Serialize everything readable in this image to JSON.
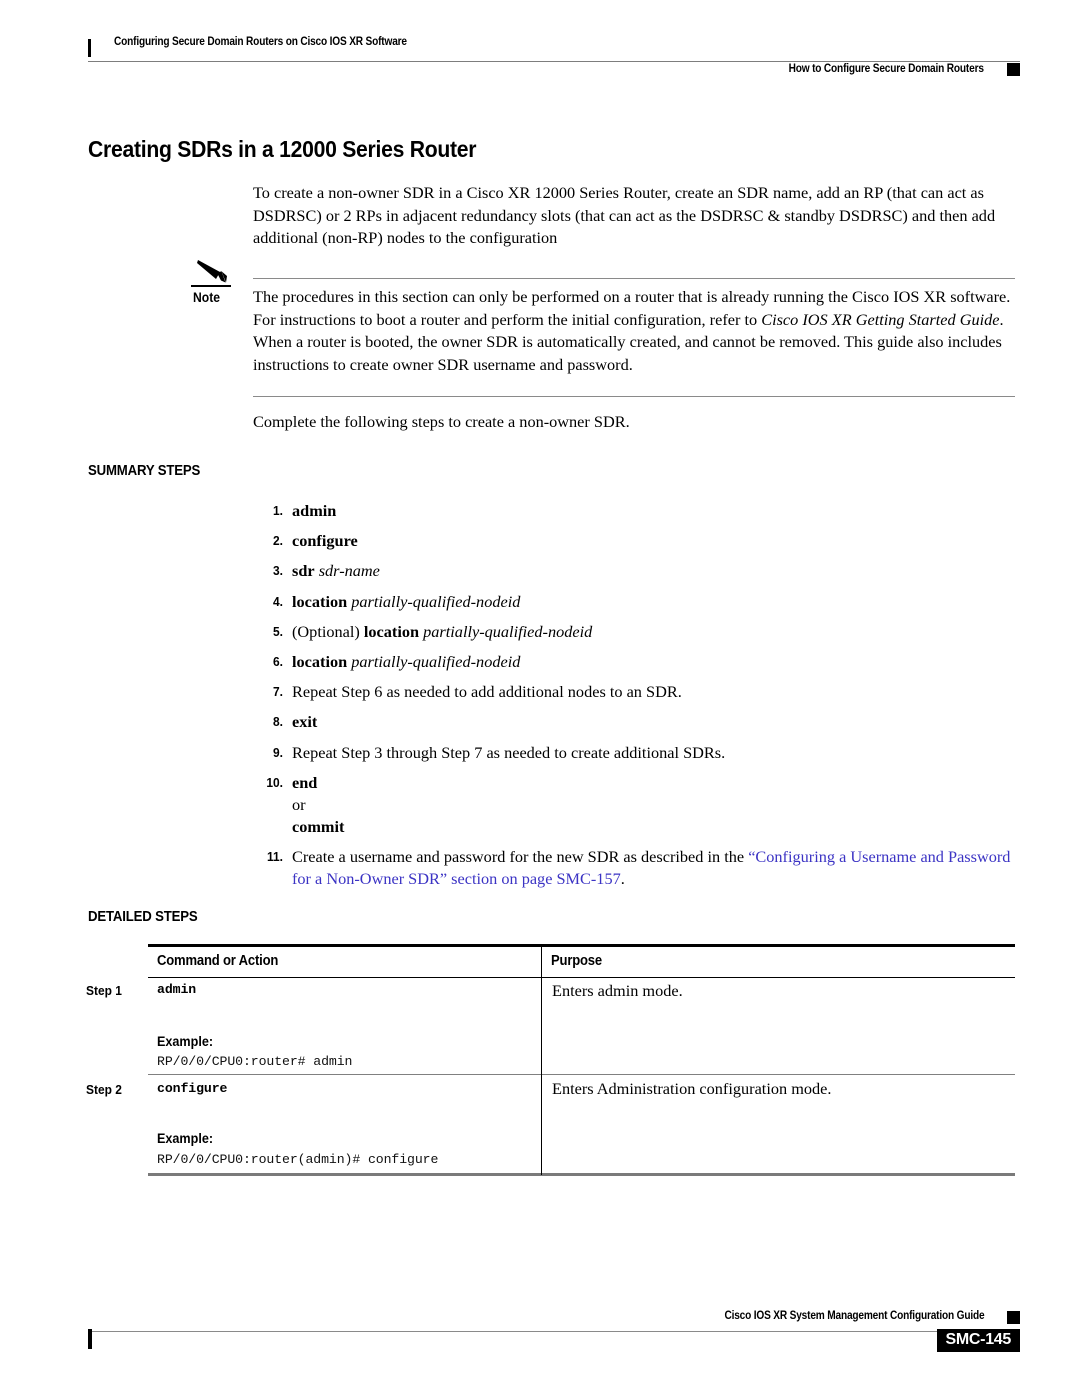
{
  "header": {
    "left_title": "Configuring Secure Domain Routers on Cisco IOS XR Software",
    "right_title": "How to Configure Secure Domain Routers"
  },
  "section": {
    "title": "Creating SDRs in a 12000 Series Router",
    "intro_paragraph": "To create a non-owner SDR in a Cisco XR 12000 Series Router, create an SDR name, add an RP (that can act as DSDRSC) or 2 RPs in adjacent redundancy slots (that can act as the DSDRSC & standby DSDRSC) and then add additional (non-RP) nodes to the configuration",
    "complete_paragraph": "Complete the following steps to create a non-owner SDR."
  },
  "note": {
    "label": "Note",
    "text_part_1": "The procedures in this section can only be performed on a router that is already running the Cisco IOS XR software. For instructions to boot a router and perform the initial configuration, refer to ",
    "text_italic": "Cisco IOS XR Getting Started Guide",
    "text_part_2": ". When a router is booted, the owner SDR is automatically created, and cannot be removed. This guide also includes instructions to create owner SDR username and password."
  },
  "summary": {
    "heading": "SUMMARY STEPS",
    "steps": [
      {
        "num": "1.",
        "command": "admin",
        "argument": "",
        "prefix": "",
        "plain": ""
      },
      {
        "num": "2.",
        "command": "configure",
        "argument": "",
        "prefix": "",
        "plain": ""
      },
      {
        "num": "3.",
        "command": "sdr",
        "argument": "sdr-name",
        "prefix": "",
        "plain": ""
      },
      {
        "num": "4.",
        "command": "location",
        "argument": "partially-qualified-nodeid",
        "prefix": "",
        "plain": ""
      },
      {
        "num": "5.",
        "command": "location",
        "argument": "partially-qualified-nodeid",
        "prefix": "(Optional) ",
        "plain": ""
      },
      {
        "num": "6.",
        "command": "location",
        "argument": "partially-qualified-nodeid",
        "prefix": "",
        "plain": ""
      },
      {
        "num": "7.",
        "command": "",
        "argument": "",
        "prefix": "",
        "plain": "Repeat Step 6 as needed to add additional nodes to an SDR."
      },
      {
        "num": "8.",
        "command": "exit",
        "argument": "",
        "prefix": "",
        "plain": ""
      },
      {
        "num": "9.",
        "command": "",
        "argument": "",
        "prefix": "",
        "plain": "Repeat Step 3 through Step 7 as needed to create additional SDRs."
      }
    ],
    "step10": {
      "num": "10.",
      "command": "end",
      "or": "or",
      "command2": "commit"
    },
    "step11": {
      "num": "11.",
      "text_before": "Create a username and password for the new SDR as described in the ",
      "link_text": "“Configuring a Username and Password for a Non-Owner SDR” section on page SMC-157",
      "text_after": ".",
      "link_color": "#3b33c4"
    }
  },
  "detailed": {
    "heading": "DETAILED STEPS",
    "columns": {
      "command": "Command or Action",
      "purpose": "Purpose"
    },
    "rows": [
      {
        "step_label": "Step 1",
        "command": "admin",
        "example_label": "Example:",
        "example_code": "RP/0/0/CPU0:router# admin",
        "purpose": "Enters admin mode."
      },
      {
        "step_label": "Step 2",
        "command": "configure",
        "example_label": "Example:",
        "example_code": "RP/0/0/CPU0:router(admin)# configure",
        "purpose": "Enters Administration configuration mode."
      }
    ]
  },
  "footer": {
    "guide_title": "Cisco IOS XR System Management Configuration Guide",
    "page_number": "SMC-145"
  }
}
